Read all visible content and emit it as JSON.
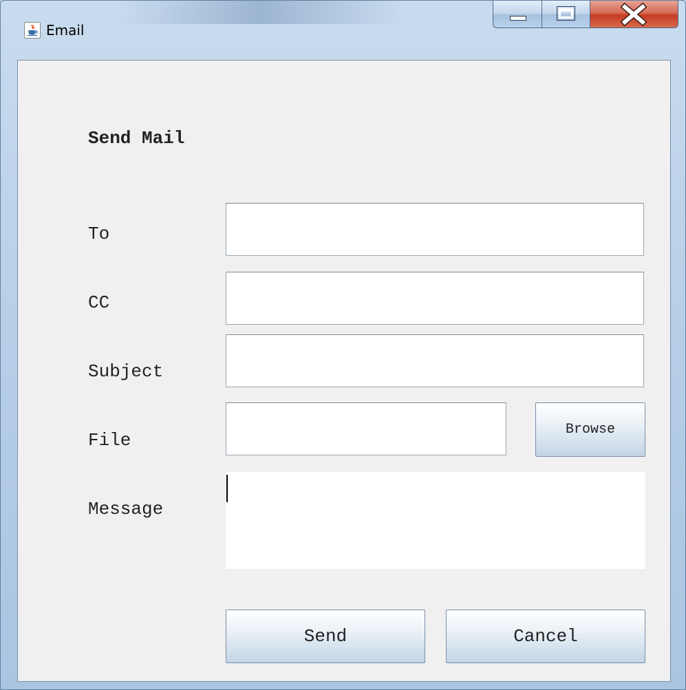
{
  "window": {
    "title": "Email"
  },
  "form": {
    "heading": "Send Mail",
    "to_label": "To",
    "cc_label": "CC",
    "subject_label": "Subject",
    "file_label": "File",
    "message_label": "Message",
    "to_value": "",
    "cc_value": "",
    "subject_value": "",
    "file_value": "",
    "message_value": ""
  },
  "buttons": {
    "browse": "Browse",
    "send": "Send",
    "cancel": "Cancel"
  },
  "icons": {
    "app": "java-cup-icon",
    "minimize": "minimize-icon",
    "maximize": "maximize-icon",
    "close": "close-icon"
  },
  "colors": {
    "client_background": "#f0f0f0",
    "close_button": "#c53c22",
    "button_gradient_bottom": "#c3d4e6"
  }
}
